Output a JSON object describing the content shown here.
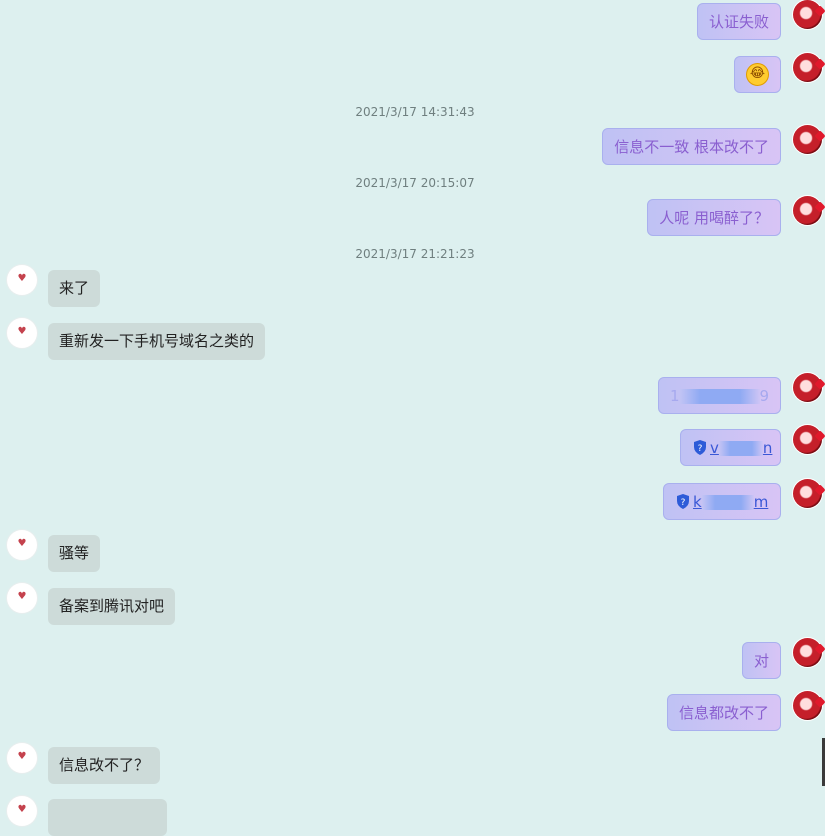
{
  "colors": {
    "background": "#ddf0ef",
    "outgoing_bubble": "#c9c3f5",
    "outgoing_text": "#8a5fd0",
    "incoming_bubble": "#cddbd9",
    "incoming_text": "#222222",
    "timestamp": "#6f7f7f"
  },
  "timestamps": [
    "2021/3/17 14:31:43",
    "2021/3/17 20:15:07",
    "2021/3/17 21:21:23"
  ],
  "messages": {
    "m1": "认证失败",
    "m2_icon": "crying-laughing-emoji",
    "m3": "信息不一致  根本改不了",
    "m4": "人呢  用喝醉了？",
    "m5": "来了",
    "m6": "重新发一下手机号域名之类的",
    "m7_prefix": "1",
    "m7_suffix": "9",
    "m8_prefix": "v",
    "m8_suffix": "n",
    "m9_prefix": "k",
    "m9_suffix": "m",
    "m10": "骚等",
    "m11": "备案到腾讯对吧",
    "m12": "对",
    "m13": "信息都改不了",
    "m14": "信息改不了？"
  },
  "icons": {
    "outgoing_avatar": "red-strawberry-avatar",
    "incoming_avatar": "white-heart-avatar",
    "link_icon": "shield-question-icon"
  }
}
